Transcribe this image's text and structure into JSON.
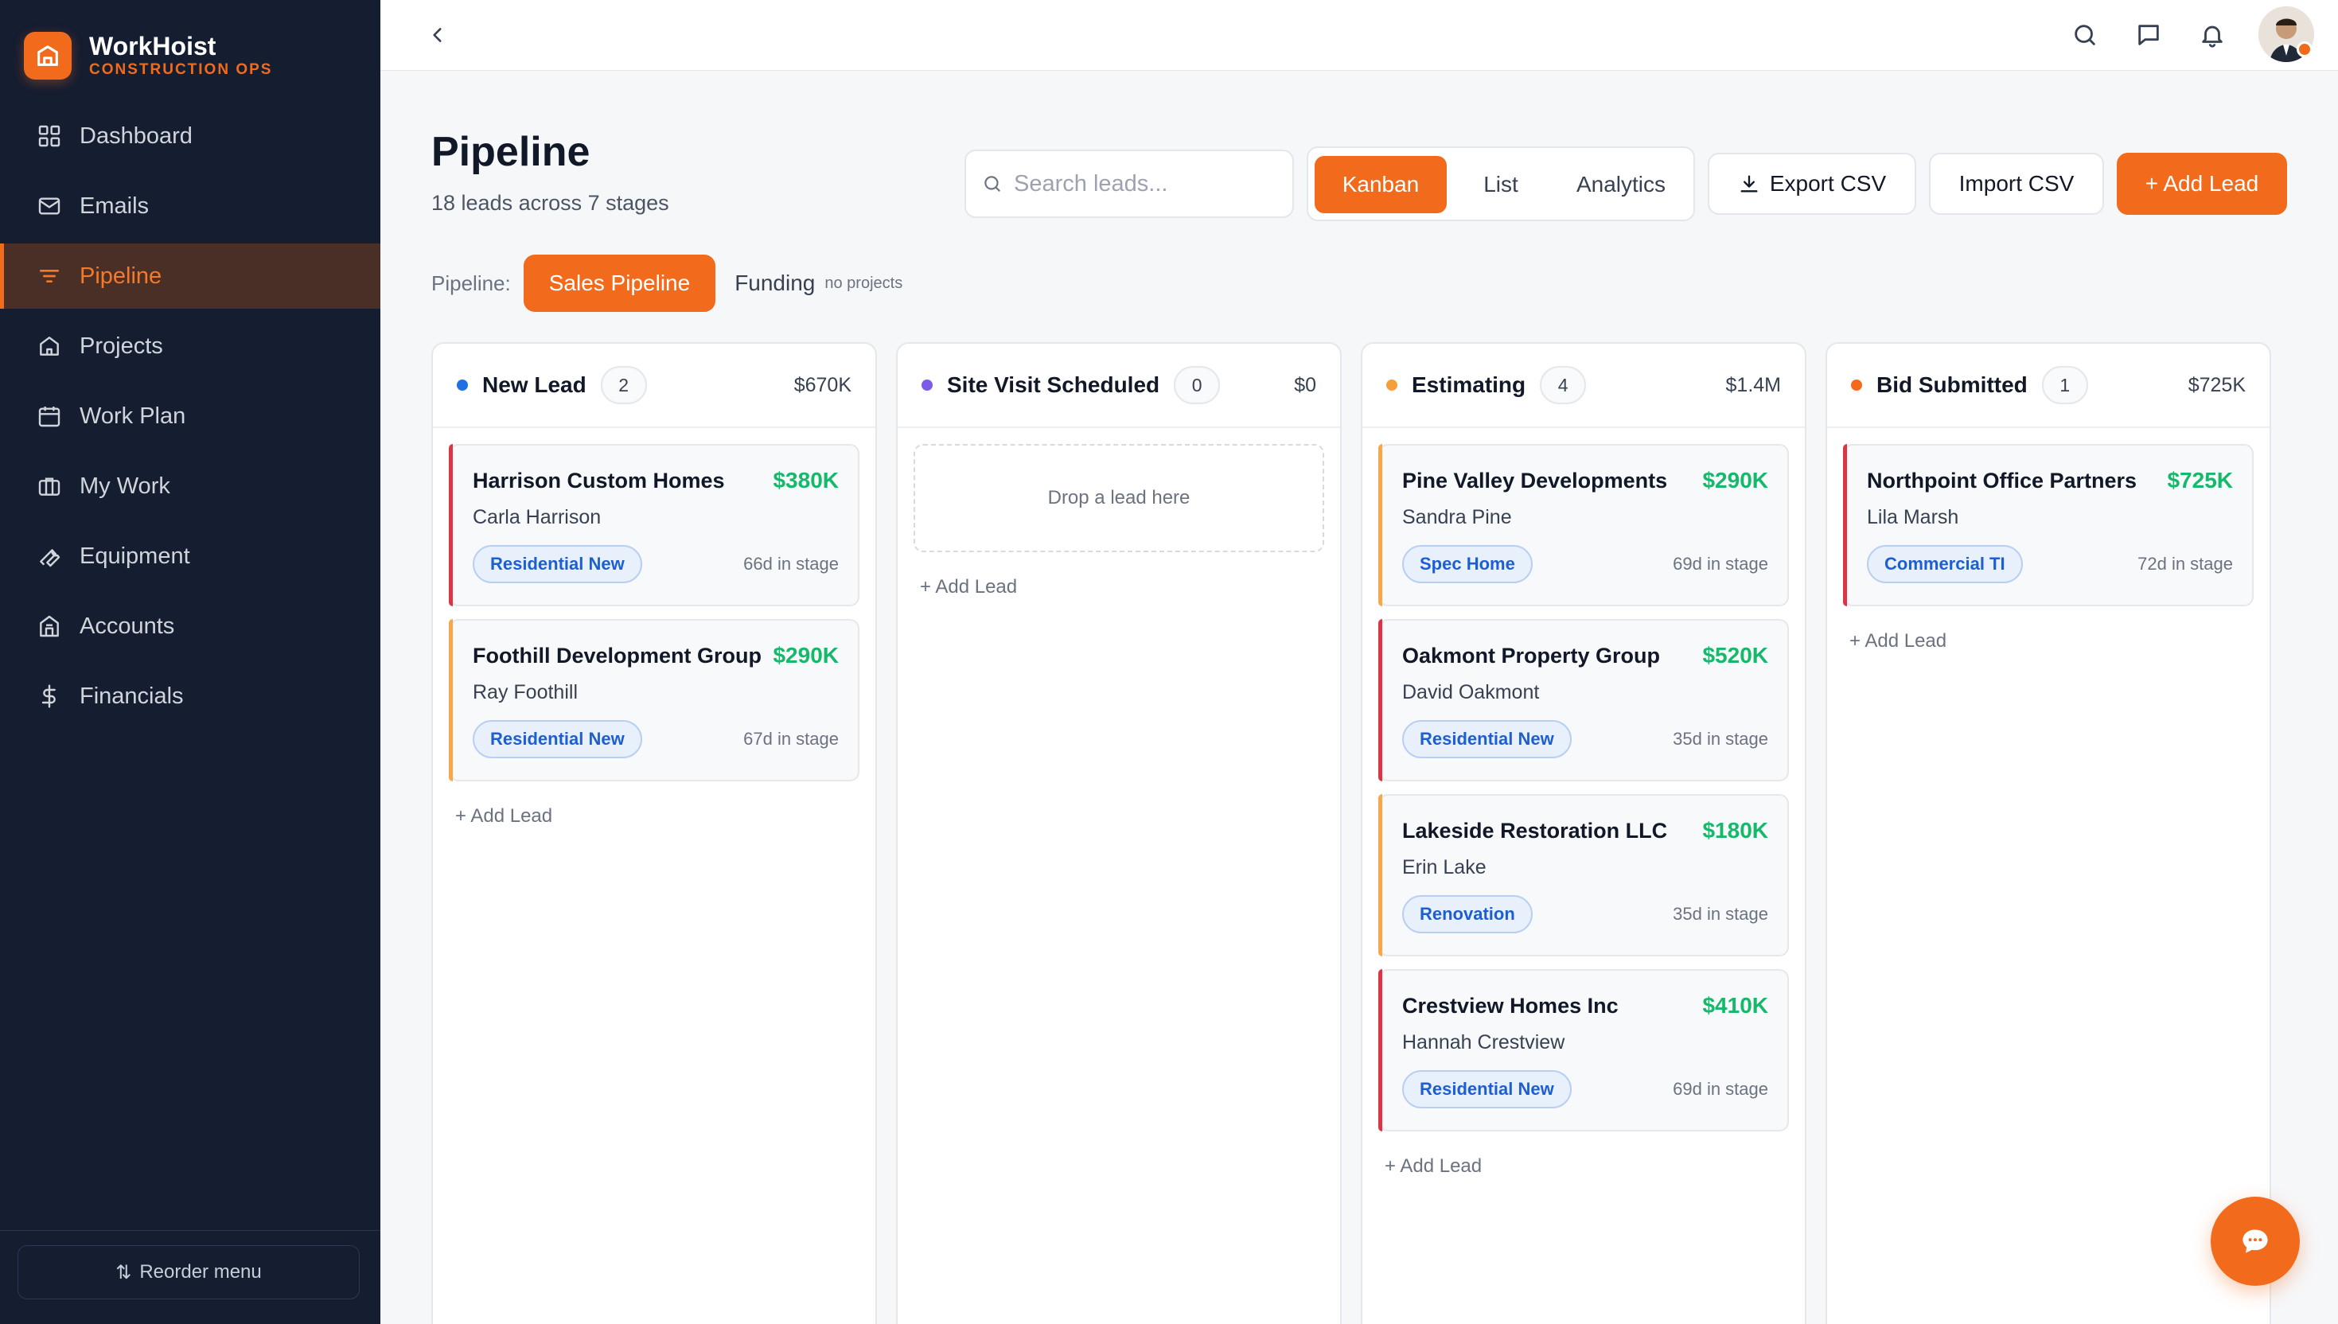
{
  "brand": {
    "name": "WorkHoist",
    "subtitle": "CONSTRUCTION OPS"
  },
  "sidebar": {
    "items": [
      {
        "label": "Dashboard",
        "icon": "grid-icon"
      },
      {
        "label": "Emails",
        "icon": "mail-icon"
      },
      {
        "label": "Pipeline",
        "icon": "filter-icon",
        "active": true
      },
      {
        "label": "Projects",
        "icon": "home-icon"
      },
      {
        "label": "Work Plan",
        "icon": "calendar-icon"
      },
      {
        "label": "My Work",
        "icon": "briefcase-icon"
      },
      {
        "label": "Equipment",
        "icon": "wrench-icon"
      },
      {
        "label": "Accounts",
        "icon": "building-icon"
      },
      {
        "label": "Financials",
        "icon": "dollar-icon"
      }
    ],
    "footer": {
      "reorder_label": "Reorder menu"
    }
  },
  "header": {
    "title": "Pipeline",
    "subtitle": "18 leads across 7 stages",
    "search_placeholder": "Search leads...",
    "views": [
      "Kanban",
      "List",
      "Analytics"
    ],
    "active_view": "Kanban",
    "export_label": "Export CSV",
    "import_label": "Import CSV",
    "add_label": "+ Add Lead"
  },
  "pipeline_selector": {
    "label": "Pipeline:",
    "options": [
      {
        "label": "Sales Pipeline",
        "active": true
      },
      {
        "label": "Funding",
        "hint": "no projects"
      }
    ]
  },
  "colors": {
    "accent": "#f26b1d",
    "sidebar_bg": "#151d31",
    "value_green": "#16b86a",
    "stage_new_lead": "#1f6fe5",
    "stage_site_visit": "#7c5ce6",
    "stage_estimating": "#f59e3a",
    "stage_bid_submitted": "#f26b1d",
    "accent_red": "#dc3545",
    "accent_amber": "#f5a74a"
  },
  "columns": [
    {
      "title": "New Lead",
      "count": "2",
      "total": "$670K",
      "cards": [
        {
          "company": "Harrison Custom Homes",
          "value": "$380K",
          "contact": "Carla Harrison",
          "tag": "Residential New",
          "age": "66d in stage"
        },
        {
          "company": "Foothill Development Group",
          "value": "$290K",
          "contact": "Ray Foothill",
          "tag": "Residential New",
          "age": "67d in stage"
        }
      ],
      "add_label": "+ Add Lead"
    },
    {
      "title": "Site Visit Scheduled",
      "count": "0",
      "total": "$0",
      "empty_label": "Drop a lead here",
      "add_label": "+ Add Lead"
    },
    {
      "title": "Estimating",
      "count": "4",
      "total": "$1.4M",
      "cards": [
        {
          "company": "Pine Valley Developments",
          "value": "$290K",
          "contact": "Sandra Pine",
          "tag": "Spec Home",
          "age": "69d in stage"
        },
        {
          "company": "Oakmont Property Group",
          "value": "$520K",
          "contact": "David Oakmont",
          "tag": "Residential New",
          "age": "35d in stage"
        },
        {
          "company": "Lakeside Restoration LLC",
          "value": "$180K",
          "contact": "Erin Lake",
          "tag": "Renovation",
          "age": "35d in stage"
        },
        {
          "company": "Crestview Homes Inc",
          "value": "$410K",
          "contact": "Hannah Crestview",
          "tag": "Residential New",
          "age": "69d in stage"
        }
      ],
      "add_label": "+ Add Lead"
    },
    {
      "title": "Bid Submitted",
      "count": "1",
      "total": "$725K",
      "cards": [
        {
          "company": "Northpoint Office Partners",
          "value": "$725K",
          "contact": "Lila Marsh",
          "tag": "Commercial TI",
          "age": "72d in stage"
        }
      ],
      "add_label": "+ Add Lead"
    }
  ]
}
